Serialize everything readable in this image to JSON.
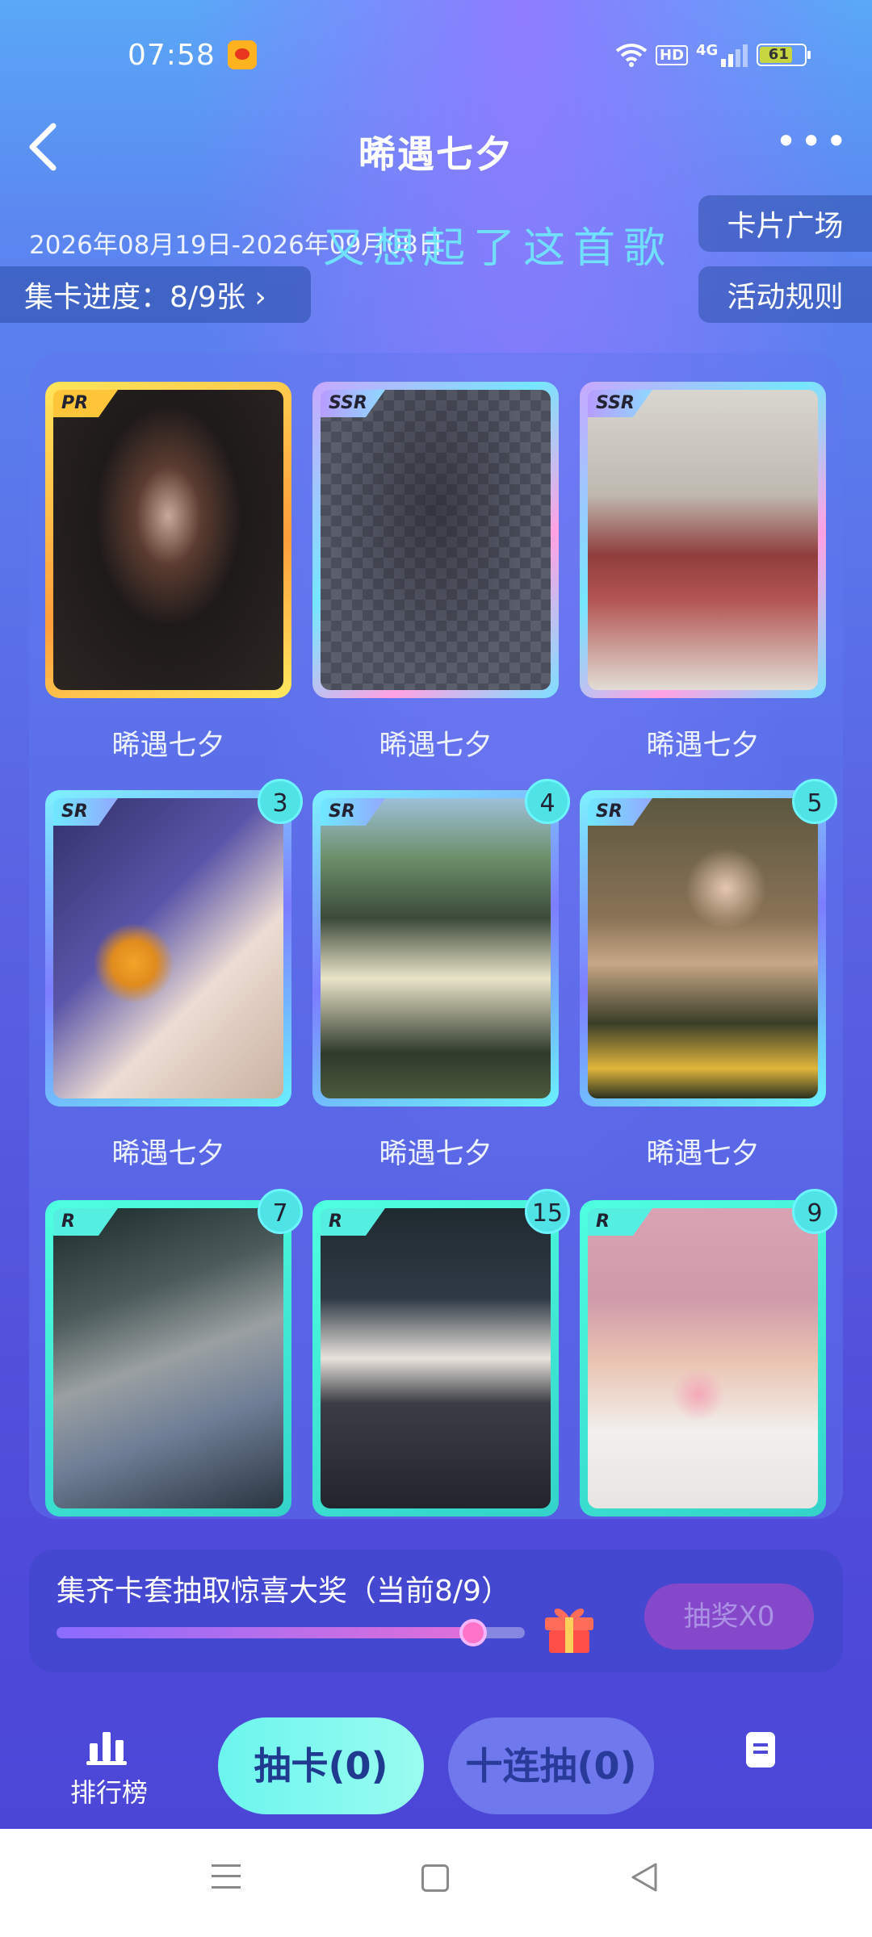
{
  "status_bar": {
    "time": "07:58",
    "network": "4G",
    "hd": "HD",
    "battery": "61"
  },
  "header": {
    "title": "晞遇七夕",
    "back_icon": "chevron-left-icon",
    "more_label": "•••"
  },
  "event": {
    "date_range": "2026年08月19日-2026年09月08日",
    "lyric_overlay": "又想起了这首歌",
    "progress_label": "集卡进度：8/9张 ›",
    "card_square_label": "卡片广场",
    "rules_label": "活动规则"
  },
  "cards": [
    {
      "rarity": "PR",
      "name": "晞遇七夕",
      "count": "",
      "owned": true
    },
    {
      "rarity": "SSR",
      "name": "晞遇七夕",
      "count": "",
      "owned": false
    },
    {
      "rarity": "SSR",
      "name": "晞遇七夕",
      "count": "",
      "owned": true
    },
    {
      "rarity": "SR",
      "name": "晞遇七夕",
      "count": "3",
      "owned": true
    },
    {
      "rarity": "SR",
      "name": "晞遇七夕",
      "count": "4",
      "owned": true
    },
    {
      "rarity": "SR",
      "name": "晞遇七夕",
      "count": "5",
      "owned": true
    },
    {
      "rarity": "R",
      "name": "",
      "count": "7",
      "owned": true
    },
    {
      "rarity": "R",
      "name": "",
      "count": "15",
      "owned": true
    },
    {
      "rarity": "R",
      "name": "",
      "count": "9",
      "owned": true
    }
  ],
  "prize": {
    "text": "集齐卡套抽取惊喜大奖（当前8/9）",
    "progress": 0.89,
    "draw_button": "抽奖X0",
    "gift_icon": "gift-icon"
  },
  "bottom": {
    "rank_label": "排行榜",
    "rank_icon": "bar-chart-icon",
    "draw_label": "抽卡(0)",
    "ten_draw_label": "十连抽(0)",
    "doc_icon": "document-icon"
  },
  "colors": {
    "accent_cyan": "#6bf5ee",
    "pr_gold": "#ffc53a",
    "badge": "#4fe3e6",
    "prize_button": "#a149c8"
  }
}
